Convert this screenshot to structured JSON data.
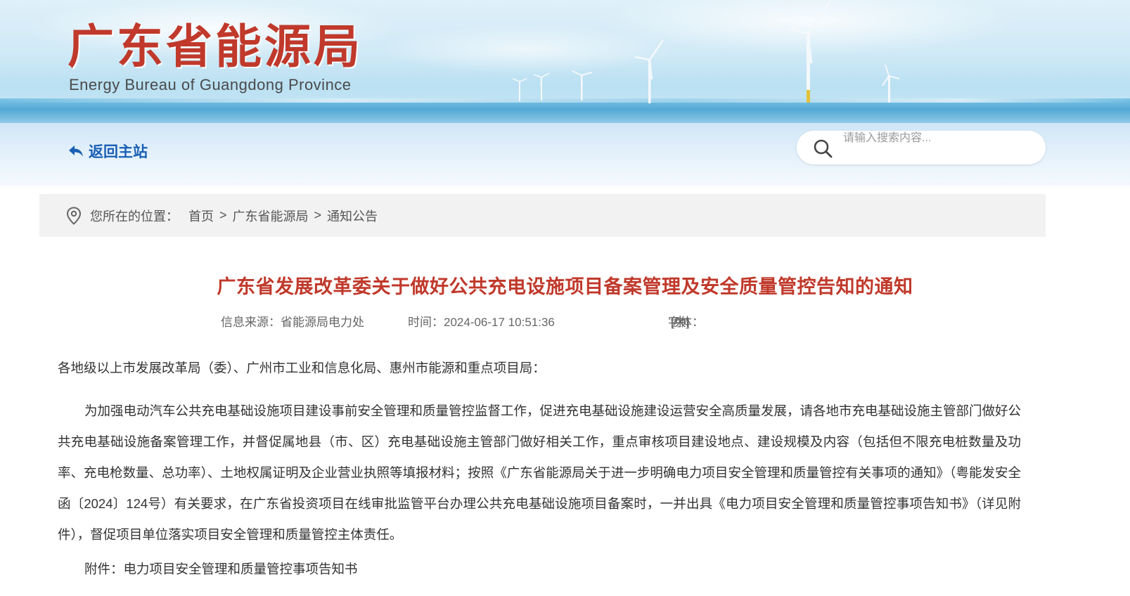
{
  "header": {
    "logo_cn": "广东省能源局",
    "logo_en": "Energy Bureau of Guangdong Province"
  },
  "nav": {
    "back_label": "返回主站",
    "search_placeholder": "请输入搜索内容..."
  },
  "breadcrumb": {
    "label": "您所在的位置：",
    "items": [
      "首页",
      "广东省能源局",
      "通知公告"
    ],
    "separator": ">"
  },
  "article": {
    "title": "广东省发展改革委关于做好公共充电设施项目备案管理及安全质量管控告知的通知",
    "source": "信息来源：省能源局电力处",
    "time": "时间：2024-06-17 10:51:36",
    "font_label": "字体：",
    "font_sizes": [
      "[大]",
      "[中]",
      "[小]"
    ],
    "salutation": "各地级以上市发展改革局（委）、广州市工业和信息化局、惠州市能源和重点项目局：",
    "paragraph": "为加强电动汽车公共充电基础设施项目建设事前安全管理和质量管控监督工作，促进充电基础设施建设运营安全高质量发展，请各地市充电基础设施主管部门做好公共充电基础设施备案管理工作，并督促属地县（市、区）充电基础设施主管部门做好相关工作，重点审核项目建设地点、建设规模及内容（包括但不限充电桩数量及功率、充电枪数量、总功率）、土地权属证明及企业营业执照等填报材料；按照《广东省能源局关于进一步明确电力项目安全管理和质量管控有关事项的通知》（粤能发安全函〔2024〕124号）有关要求，在广东省投资项目在线审批监管平台办理公共充电基础设施项目备案时，一并出具《电力项目安全管理和质量管控事项告知书》（详见附件），督促项目单位落实项目安全管理和质量管控主体责任。",
    "attachment": "附件：电力项目安全管理和质量管控事项告知书"
  },
  "colors": {
    "title_red": "#c0392b",
    "link_blue": "#1a5fb4",
    "breadcrumb_bg": "#f2f2f2"
  },
  "icons": [
    "back-arrow-icon",
    "search-icon",
    "location-pin-icon",
    "wind-turbine-icon"
  ]
}
